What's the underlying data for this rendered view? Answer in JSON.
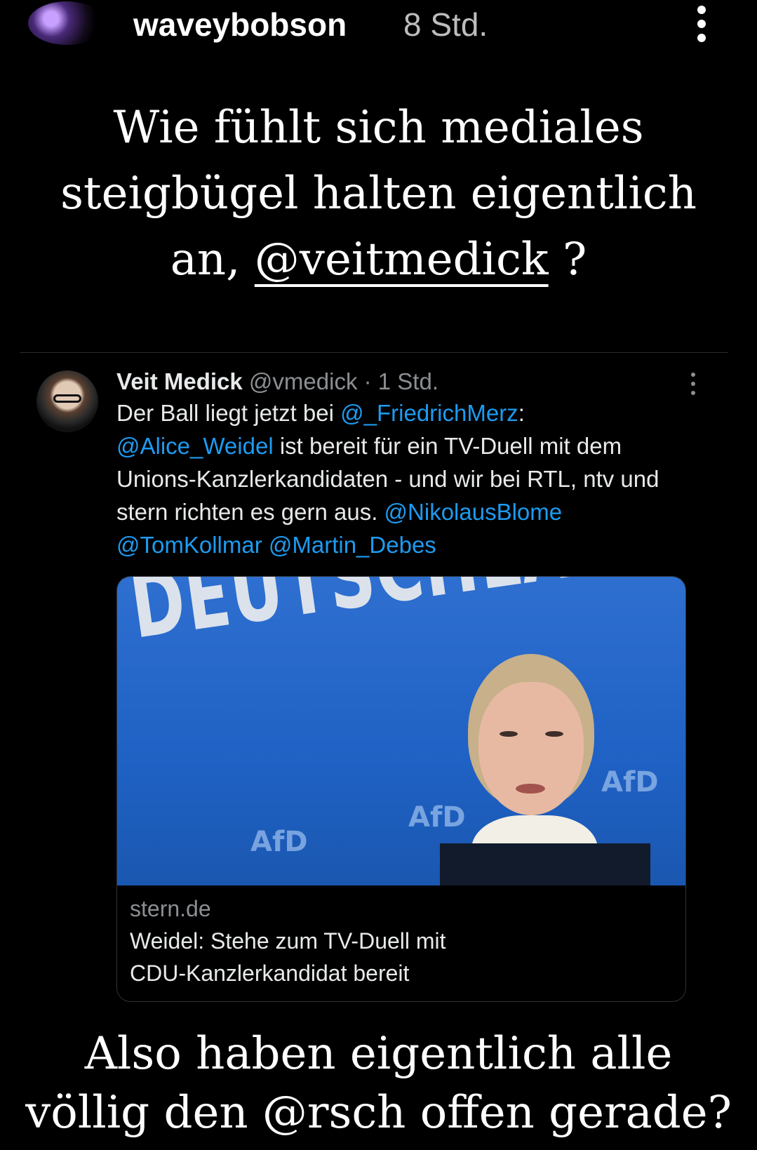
{
  "story": {
    "username": "waveybobson",
    "time": "8 Std.",
    "top_text": {
      "line1": "Wie fühlt sich mediales",
      "line2": "steigbügel halten eigentlich",
      "line3_prefix": "an, ",
      "mention": "@veitmedick",
      "line3_suffix": " ?"
    },
    "bottom_text": {
      "line1": "Also haben eigentlich alle",
      "line2": "völlig den @rsch offen gerade?"
    }
  },
  "tweet": {
    "name": "Veit Medick",
    "handle": "@vmedick · 1 Std.",
    "text_1": "Der Ball liegt jetzt bei ",
    "mention_1": "@_FriedrichMerz",
    "text_2": ":",
    "mention_2": "@Alice_Weidel",
    "text_3": " ist bereit für ein TV-Duell mit dem Unions-Kanzlerkandidaten - und wir bei RTL, ntv und stern richten es gern aus. ",
    "mention_3": "@NikolausBlome",
    "mention_4": "@TomKollmar",
    "mention_5": "@Martin_Debes",
    "link_card": {
      "image_banner_text": "DEUTSCHLAND.",
      "image_logo_text": "AfD",
      "domain": "stern.de",
      "title_line1": "Weidel: Stehe zum TV-Duell mit",
      "title_line2": "CDU-Kanzlerkandidat bereit"
    }
  },
  "colors": {
    "link": "#1d9bf0",
    "background": "#000000",
    "photo_blue": "#1f61c4"
  }
}
